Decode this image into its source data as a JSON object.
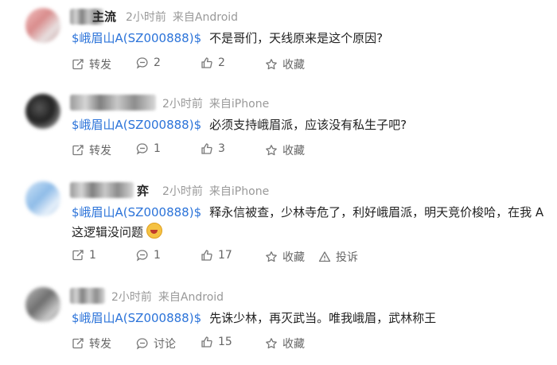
{
  "comments": [
    {
      "nick_visible": "主流",
      "time": "2小时前",
      "source": "来自Android",
      "tag": "$峨眉山A(SZ000888)$",
      "text": "不是哥们，天线原来是这个原因?",
      "text2": "",
      "actions": {
        "repost": "转发",
        "comment": "2",
        "like": "2",
        "fav": "收藏",
        "report": ""
      }
    },
    {
      "nick_visible": "",
      "time": "2小时前",
      "source": "来自iPhone",
      "tag": "$峨眉山A(SZ000888)$",
      "text": "必须支持峨眉派，应该没有私生子吧?",
      "text2": "",
      "actions": {
        "repost": "转发",
        "comment": "1",
        "like": "3",
        "fav": "收藏",
        "report": ""
      }
    },
    {
      "nick_visible": "弈",
      "time": "2小时前",
      "source": "来自iPhone",
      "tag": "$峨眉山A(SZ000888)$",
      "text": "释永信被查，少林寺危了，利好峨眉派，明天竞价梭哈，在我 A",
      "text2": "这逻辑没问题",
      "actions": {
        "repost": "1",
        "comment": "1",
        "like": "17",
        "fav": "收藏",
        "report": "投诉"
      }
    },
    {
      "nick_visible": "",
      "time": "2小时前",
      "source": "来自Android",
      "tag": "$峨眉山A(SZ000888)$",
      "text": "先诛少林，再灭武当。唯我峨眉，武林称王",
      "text2": "",
      "actions": {
        "repost": "转发",
        "comment": "讨论",
        "like": "15",
        "fav": "收藏",
        "report": ""
      }
    }
  ],
  "icons": [
    "repost-icon",
    "comment-icon",
    "like-icon",
    "favorite-icon",
    "report-icon"
  ],
  "colors": {
    "tag": "#2b73d9",
    "meta": "#999999",
    "action": "#666666"
  }
}
